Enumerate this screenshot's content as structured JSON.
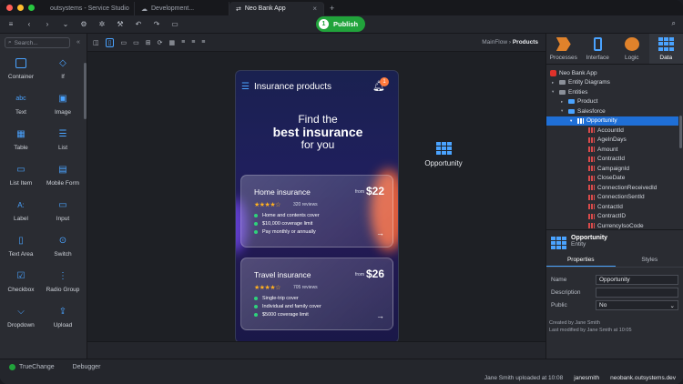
{
  "window": {
    "tabs": [
      {
        "label": "outsystems - Service Studio"
      },
      {
        "label": "Development..."
      },
      {
        "label": "Neo Bank App"
      }
    ],
    "publish": {
      "step": "1",
      "label": "Publish"
    }
  },
  "left_panel": {
    "search_placeholder": "Search...",
    "widgets": [
      {
        "label": "Container",
        "icon": "container-icon"
      },
      {
        "label": "If",
        "icon": "if-icon"
      },
      {
        "label": "Text",
        "icon": "text-icon"
      },
      {
        "label": "Image",
        "icon": "image-icon"
      },
      {
        "label": "Table",
        "icon": "table-icon"
      },
      {
        "label": "List",
        "icon": "list-icon"
      },
      {
        "label": "List Item",
        "icon": "list-item-icon"
      },
      {
        "label": "Mobile Form",
        "icon": "mobile-form-icon"
      },
      {
        "label": "Label",
        "icon": "label-icon"
      },
      {
        "label": "Input",
        "icon": "input-icon"
      },
      {
        "label": "Text Area",
        "icon": "text-area-icon"
      },
      {
        "label": "Switch",
        "icon": "switch-icon"
      },
      {
        "label": "Checkbox",
        "icon": "checkbox-icon"
      },
      {
        "label": "Radio Group",
        "icon": "radio-group-icon"
      },
      {
        "label": "Dropdown",
        "icon": "dropdown-icon"
      },
      {
        "label": "Upload",
        "icon": "upload-icon"
      }
    ]
  },
  "canvas": {
    "breadcrumb": {
      "parent": "MainFlow",
      "current": "Products"
    },
    "phone": {
      "header_title": "Insurance products",
      "badge_count": "1",
      "hero": {
        "line1": "Find the",
        "line2": "best insurance",
        "line3": "for you"
      },
      "cards": [
        {
          "title": "Home insurance",
          "from": "from",
          "price": "$22",
          "stars": "★★★★☆",
          "reviews": "320 reviews",
          "features": [
            "Home and contents cover",
            "$10,000 coverage limit",
            "Pay monthly or annually"
          ]
        },
        {
          "title": "Travel insurance",
          "from": "from",
          "price": "$26",
          "stars": "★★★★☆",
          "reviews": "705 reviews",
          "features": [
            "Single-trip cover",
            "Individual and family cover",
            "$5000 coverage limit"
          ]
        }
      ]
    },
    "entity_label": "Opportunity"
  },
  "right_panel": {
    "tabs": [
      {
        "label": "Processes"
      },
      {
        "label": "Interface"
      },
      {
        "label": "Logic"
      },
      {
        "label": "Data"
      }
    ],
    "tree": {
      "app": "Neo Bank App",
      "entity_diagrams": "Entity Diagrams",
      "entities": "Entities",
      "product": "Product",
      "salesforce": "Salesforce",
      "opportunity": "Opportunity",
      "attributes": [
        "AccountId",
        "AgeInDays",
        "Amount",
        "ContractId",
        "CampaignId",
        "CloseDate",
        "ConnectionReceivedId",
        "ConnectionSentId",
        "ContactId",
        "ContractID",
        "CurrencyIsoCode"
      ]
    },
    "selected": {
      "name": "Opportunity",
      "type": "Entity"
    },
    "prop_tabs": {
      "properties": "Properties",
      "styles": "Styles"
    },
    "props": {
      "name_label": "Name",
      "name_value": "Opportunity",
      "desc_label": "Description",
      "desc_value": "",
      "public_label": "Public",
      "public_value": "No"
    },
    "meta": {
      "created": "Created by Jane Smith",
      "modified": "Last modified by Jane Smith at 10:05"
    }
  },
  "status_bar": {
    "truechange": "TrueChange",
    "debugger": "Debugger",
    "upload_info": "Jane Smith uploaded at 10:08",
    "user": "janesmith",
    "server": "neobank.outsystems.dev"
  }
}
